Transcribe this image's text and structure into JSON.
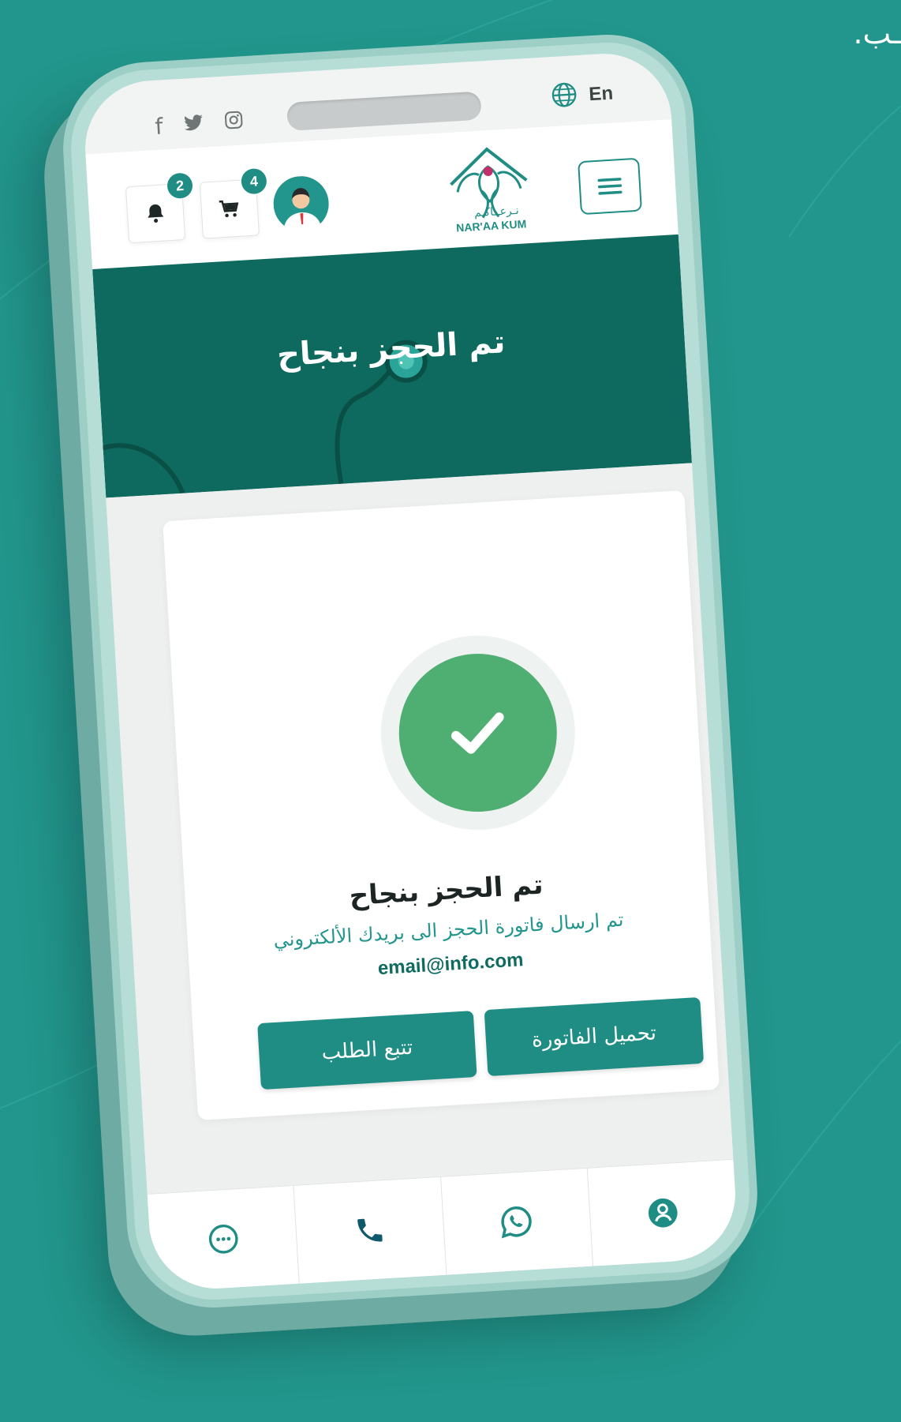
{
  "caption": "ـب.",
  "status_bar": {
    "socials": [
      "f",
      "𝕏",
      "◎"
    ],
    "lang_label": "En"
  },
  "header": {
    "notification_count": "2",
    "cart_count": "4",
    "logo_text_ar": "نـرعــاكـم",
    "logo_text_en": "NAR'AA KUM"
  },
  "hero": {
    "title": "تم الحجز بنجاح"
  },
  "card": {
    "title": "تم الحجز بنجاح",
    "message": "تم ارسال فاتورة الحجز الى بريدك الألكتروني",
    "email": "email@info.com",
    "invoice_button": "تحميل الفاتورة",
    "track_button": "تتبع الطلب"
  },
  "colors": {
    "primary": "#1f8d84",
    "hero": "#0e6a5e",
    "success": "#4fae72",
    "background": "#22968c"
  },
  "bottom_nav": [
    "chat-icon",
    "phone-icon",
    "whatsapp-icon",
    "user-icon"
  ]
}
